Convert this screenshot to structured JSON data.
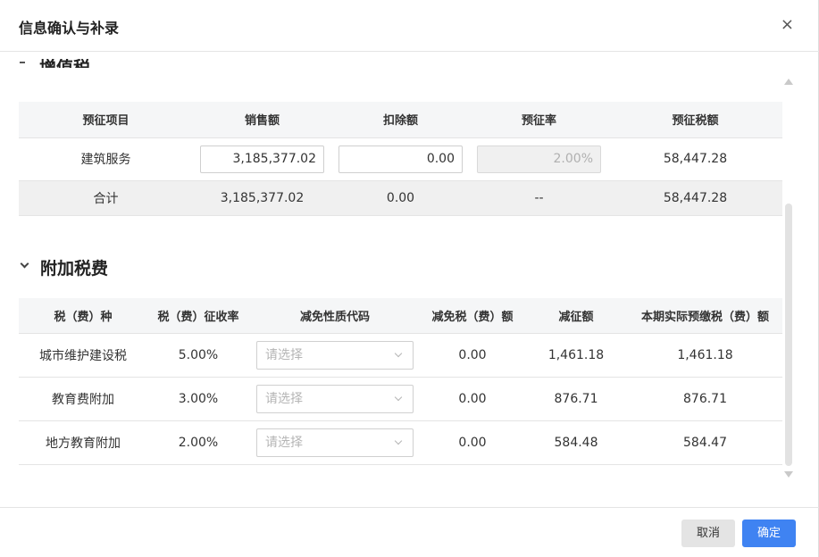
{
  "dialog": {
    "title": "信息确认与补录",
    "close_label": "×"
  },
  "vat_section": {
    "title": "增值税",
    "columns": [
      "预征项目",
      "销售额",
      "扣除额",
      "预征率",
      "预征税额"
    ],
    "row": {
      "item": "建筑服务",
      "sales": "3,185,377.02",
      "deduction": "0.00",
      "rate": "2.00%",
      "tax": "58,447.28"
    },
    "total": {
      "label": "合计",
      "sales": "3,185,377.02",
      "deduction": "0.00",
      "rate": "--",
      "tax": "58,447.28"
    }
  },
  "surcharge_section": {
    "title": "附加税费",
    "columns": [
      "税（费）种",
      "税（费）征收率",
      "减免性质代码",
      "减免税（费）额",
      "减征额",
      "本期实际预缴税（费）额"
    ],
    "select_placeholder": "请选择",
    "rows": [
      {
        "name": "城市维护建设税",
        "rate": "5.00%",
        "exempt": "0.00",
        "reduce": "1,461.18",
        "actual": "1,461.18"
      },
      {
        "name": "教育费附加",
        "rate": "3.00%",
        "exempt": "0.00",
        "reduce": "876.71",
        "actual": "876.71"
      },
      {
        "name": "地方教育附加",
        "rate": "2.00%",
        "exempt": "0.00",
        "reduce": "584.48",
        "actual": "584.47"
      }
    ]
  },
  "footer": {
    "cancel_label": "取消",
    "ok_label": "确定"
  },
  "colors": {
    "primary": "#3f83f2",
    "header_bg": "#f5f6f7",
    "total_bg": "#f0f0f0"
  }
}
